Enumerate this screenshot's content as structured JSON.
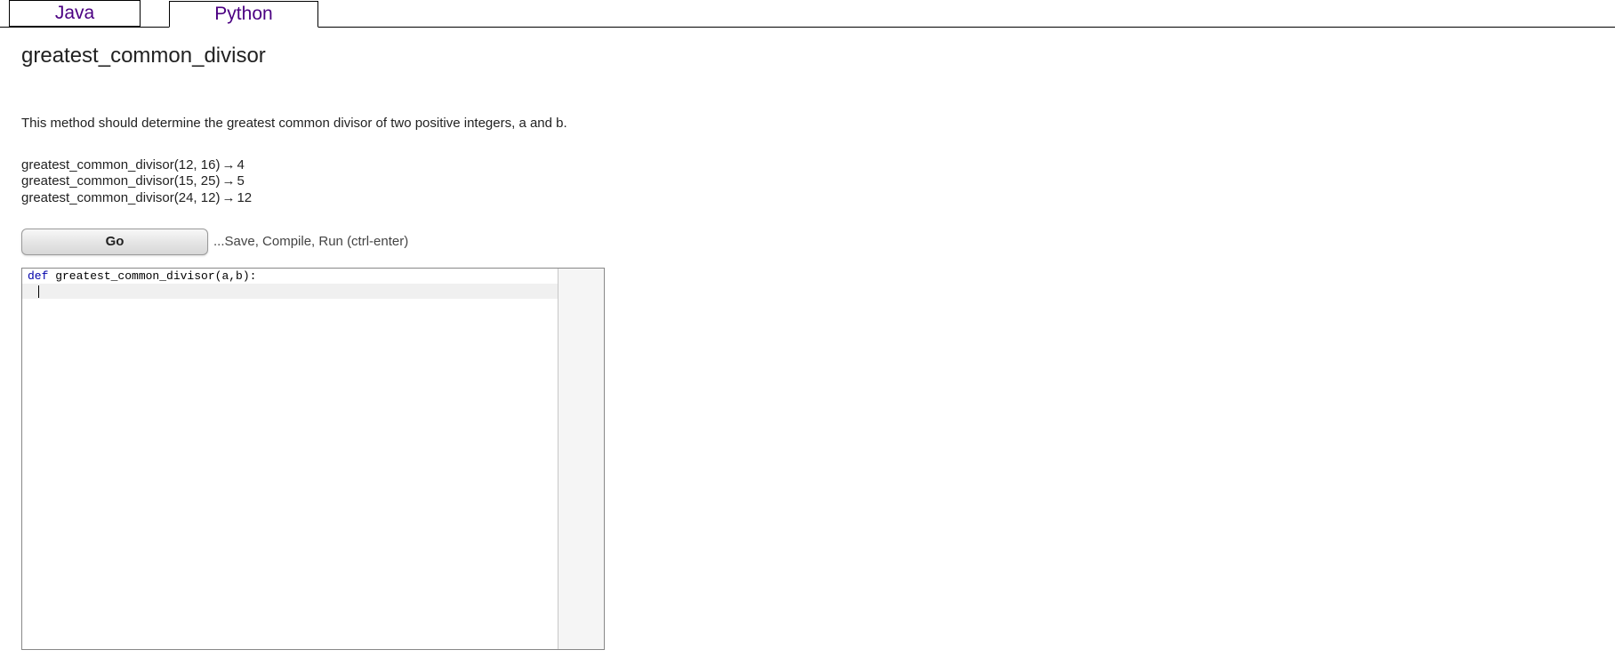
{
  "tabs": {
    "java": "Java",
    "python": "Python"
  },
  "problem": {
    "title": "greatest_common_divisor",
    "description": "This method should determine the greatest common divisor of two positive integers, a and b.",
    "examples": [
      {
        "call": "greatest_common_divisor(12, 16)",
        "result": "4"
      },
      {
        "call": "greatest_common_divisor(15, 25)",
        "result": "5"
      },
      {
        "call": "greatest_common_divisor(24, 12)",
        "result": "12"
      }
    ]
  },
  "go": {
    "label": "Go",
    "hint": "...Save, Compile, Run (ctrl-enter)"
  },
  "editor": {
    "line1_kw": "def",
    "line1_rest": " greatest_common_divisor(a,b):"
  }
}
